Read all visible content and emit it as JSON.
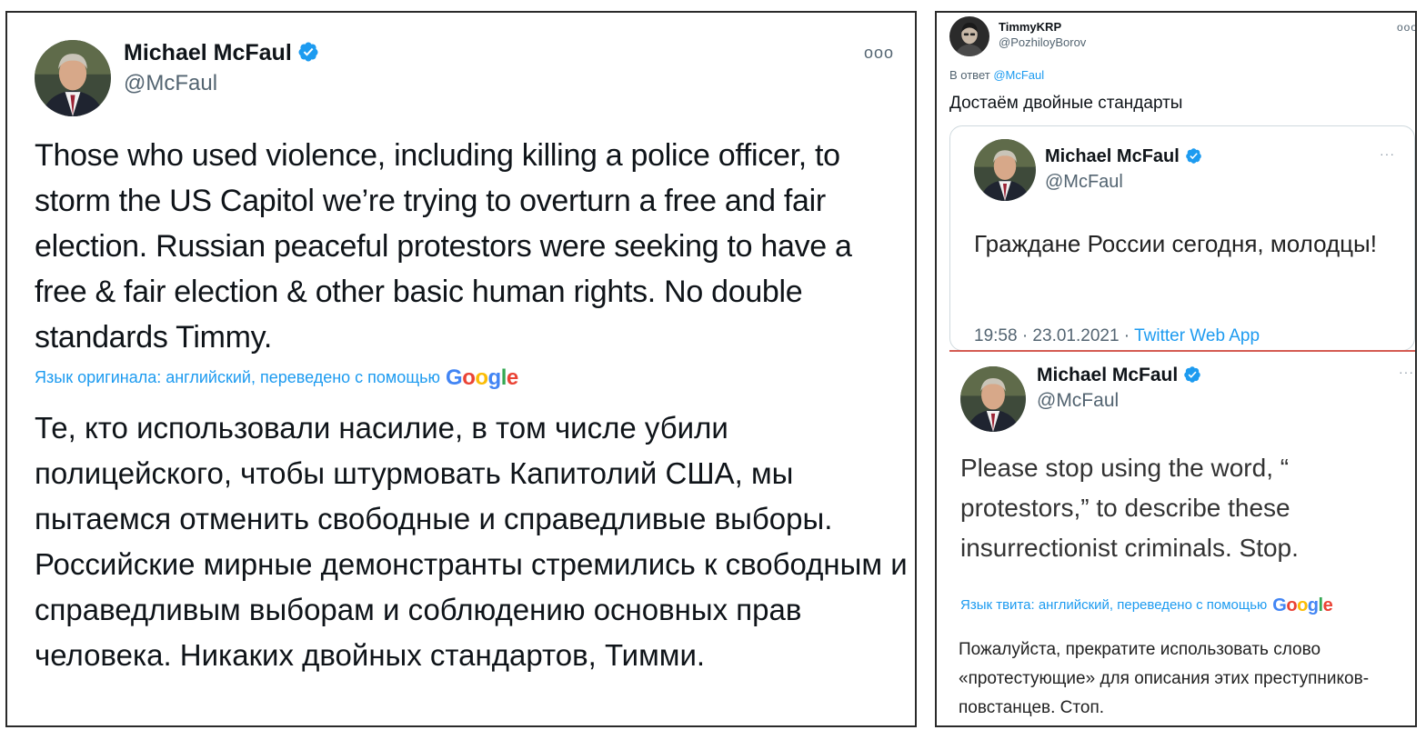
{
  "left_tweet": {
    "author_name": "Michael McFaul",
    "handle": "@McFaul",
    "verified": true,
    "more_icon": "more-horizontal-icon",
    "text": "Those who used violence, including killing a police officer, to  storm the US Capitol we’re trying to overturn a free and fair election. Russian peaceful protestors were seeking to have a free & fair election & other basic human rights. No double standards Timmy.",
    "translate_note": "Язык оригинала: английский, переведено с помощью",
    "translate_brand": [
      "G",
      "o",
      "o",
      "g",
      "l",
      "e"
    ],
    "translation": "Те, кто использовали насилие, в том числе убили полицейского, чтобы штурмовать Капитолий США, мы пытаемся отменить свободные и справедливые выборы. Российские мирные демонстранты стремились к свободным и справедливым выборам и соблюдению основных прав человека. Никаких двойных стандартов, Тимми."
  },
  "right_tweet": {
    "author_name": "TimmyKRP",
    "handle": "@PozhiloyBorov",
    "more_icon": "more-horizontal-icon",
    "reply_prefix": "В ответ",
    "reply_to": "@McFaul",
    "text": "Достаём двойные стандарты",
    "quote_1": {
      "author_name": "Michael McFaul",
      "handle": "@McFaul",
      "verified": true,
      "text": "Граждане России сегодня, молодцы!",
      "time": "19:58 · 23.01.2021 · ",
      "source": "Twitter Web App"
    },
    "quote_2": {
      "author_name": "Michael McFaul",
      "handle": "@McFaul",
      "verified": true,
      "text": "Please stop using the word, “ protestors,” to describe these insurrectionist criminals. Stop.",
      "translate_note": "Язык твита: английский, переведено с помощью",
      "translate_brand": [
        "G",
        "o",
        "o",
        "g",
        "l",
        "e"
      ],
      "translation": "Пожалуйста, прекратите использовать слово «протестующие» для описания этих преступников-повстанцев. Стоп."
    }
  },
  "colors": {
    "link": "#1d9bf0",
    "verified": "#1d9bf0",
    "secondary_text": "#536471",
    "divider": "#d45b52"
  }
}
